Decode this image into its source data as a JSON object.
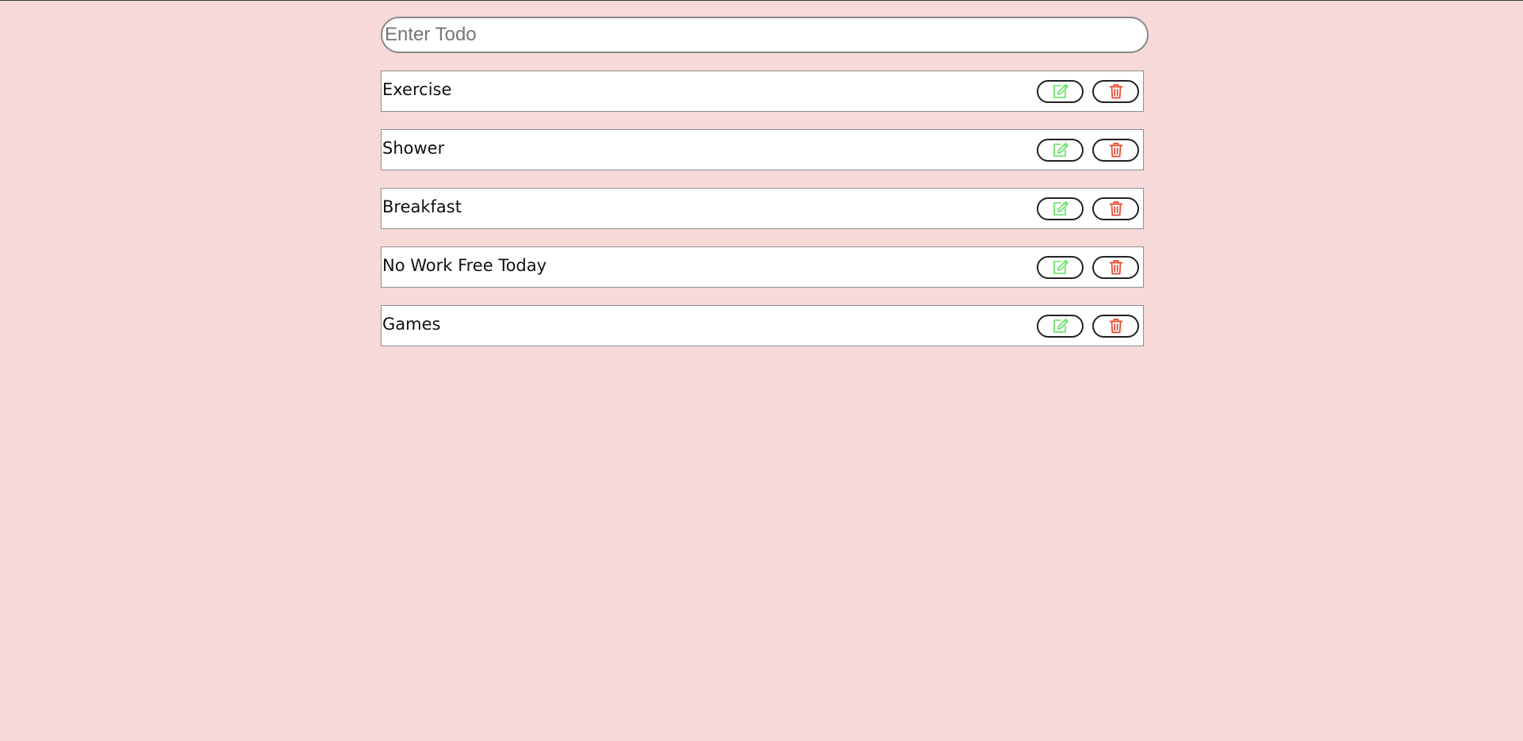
{
  "input": {
    "placeholder": "Enter Todo",
    "value": ""
  },
  "todos": [
    {
      "text": "Exercise",
      "edit_icon": "edit-icon",
      "delete_icon": "trash-icon"
    },
    {
      "text": "Shower",
      "edit_icon": "edit-icon",
      "delete_icon": "trash-icon"
    },
    {
      "text": "Breakfast",
      "edit_icon": "edit-icon",
      "delete_icon": "trash-icon"
    },
    {
      "text": "No Work Free Today",
      "edit_icon": "edit-icon",
      "delete_icon": "trash-icon"
    },
    {
      "text": "Games",
      "edit_icon": "edit-icon",
      "delete_icon": "trash-icon"
    }
  ],
  "colors": {
    "background": "#f7d9da",
    "edit_icon": "#5ee05e",
    "delete_icon": "#e8452c"
  }
}
